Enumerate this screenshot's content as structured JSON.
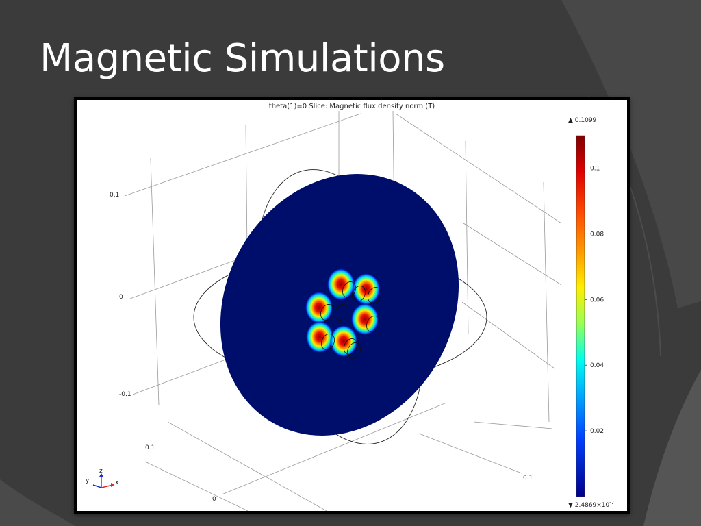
{
  "slide": {
    "title": "Magnetic Simulations"
  },
  "plot": {
    "title": "theta(1)=0  Slice: Magnetic flux density norm (T)",
    "axis_ticks": {
      "z": [
        "0.1",
        "0",
        "-0.1"
      ],
      "y": [
        "0.1",
        "0"
      ],
      "x": [
        "0.1"
      ]
    },
    "triad": {
      "x": "x",
      "y": "y",
      "z": "z"
    },
    "colorbar": {
      "max_label": "▲ 0.1099",
      "min_label": "▼ 2.4869×10",
      "min_exponent": "-7",
      "ticks": [
        "0.1",
        "0.08",
        "0.06",
        "0.04",
        "0.02"
      ],
      "ticks_values": [
        0.1,
        0.08,
        0.06,
        0.04,
        0.02
      ],
      "range": [
        2.4869e-07,
        0.1099
      ]
    },
    "colors": {
      "slice_fill": "#000e6b",
      "hot_core": "#a00000",
      "frame": "#000000",
      "background": "#ffffff"
    }
  }
}
